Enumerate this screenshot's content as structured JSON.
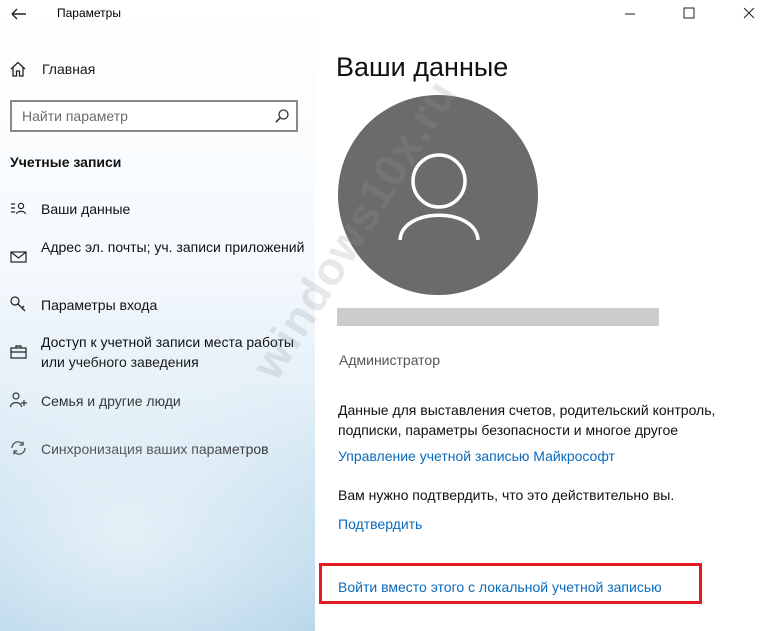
{
  "window": {
    "title": "Параметры"
  },
  "sidebar": {
    "home_label": "Главная",
    "search": {
      "placeholder": "Найти параметр"
    },
    "section_title": "Учетные записи",
    "items": [
      {
        "label": "Ваши данные",
        "icon": "person-card-icon"
      },
      {
        "label": "Адрес эл. почты; уч. записи приложений",
        "icon": "mail-icon"
      },
      {
        "label": "Параметры входа",
        "icon": "key-icon"
      },
      {
        "label": "Доступ к учетной записи места работы или учебного заведения",
        "icon": "briefcase-icon"
      },
      {
        "label": "Семья и другие люди",
        "icon": "person-add-icon"
      },
      {
        "label": "Синхронизация ваших параметров",
        "icon": "sync-icon"
      }
    ]
  },
  "main": {
    "title": "Ваши данные",
    "role": "Администратор",
    "description": "Данные для выставления счетов, родительский контроль, подписки, параметры безопасности и многое другое",
    "manage_link": "Управление учетной записью Майкрософт",
    "confirm_text": "Вам нужно подтвердить, что это действительно вы.",
    "confirm_link": "Подтвердить",
    "local_account_link": "Войти вместо этого с локальной учетной записью"
  },
  "watermark": "windows10x.ru",
  "colors": {
    "link": "#0a6bbd",
    "highlight": "#e31b23",
    "avatar_bg": "#6b6b6b"
  }
}
